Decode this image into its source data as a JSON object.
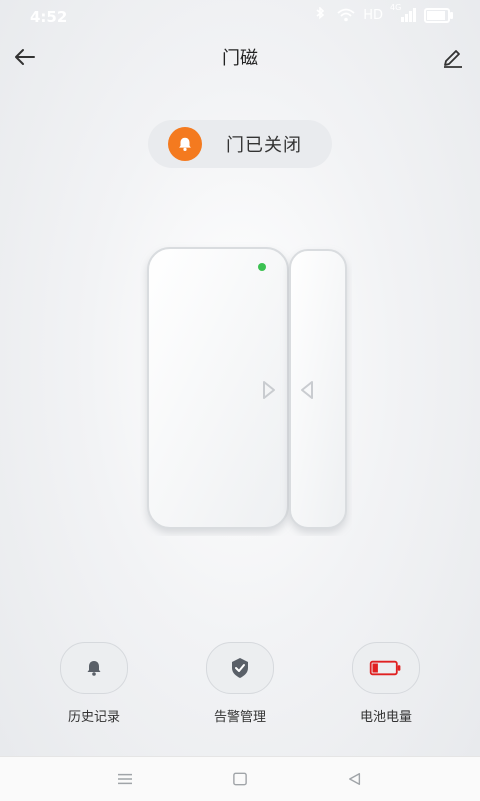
{
  "status_bar": {
    "time": "4:52",
    "network": "HD",
    "signal": "4G"
  },
  "header": {
    "title": "门磁"
  },
  "status": {
    "text": "门已关闭",
    "icon": "bell-icon",
    "accent_color": "#f47a1f"
  },
  "device": {
    "indicator_color": "#3cc152"
  },
  "actions": [
    {
      "label": "历史记录",
      "icon": "bell-icon"
    },
    {
      "label": "告警管理",
      "icon": "shield-check-icon"
    },
    {
      "label": "电池电量",
      "icon": "battery-low-icon",
      "battery_level": 0.1,
      "battery_color": "#e02020"
    }
  ],
  "nav": {
    "items": [
      "menu-icon",
      "home-icon",
      "back-icon"
    ]
  }
}
